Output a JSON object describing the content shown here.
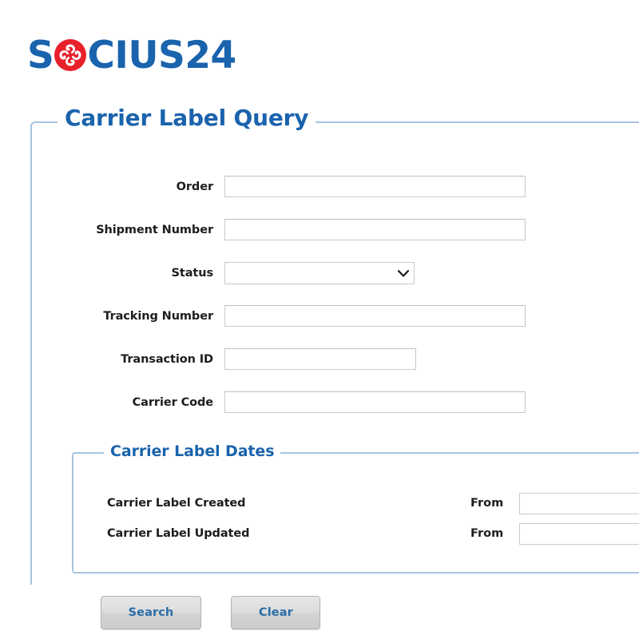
{
  "branding": {
    "logo_text_before": "S",
    "logo_mark": "socius-pinwheel-icon",
    "logo_text_after": "CIUS24",
    "logo_blue": "#1a63ad",
    "logo_red": "#e8202a"
  },
  "query_panel": {
    "legend": "Carrier Label Query",
    "border_color": "#a8c4e0",
    "fields": [
      {
        "label": "Order",
        "type": "text",
        "value": "",
        "placeholder": ""
      },
      {
        "label": "Shipment Number",
        "type": "text",
        "value": "",
        "placeholder": ""
      },
      {
        "label": "Status",
        "type": "select",
        "value": "",
        "options": [
          ""
        ]
      },
      {
        "label": "Tracking Number",
        "type": "text",
        "value": "",
        "placeholder": ""
      },
      {
        "label": "Transaction ID",
        "type": "text",
        "value": "",
        "placeholder": ""
      },
      {
        "label": "Carrier Code",
        "type": "text",
        "value": "",
        "placeholder": ""
      }
    ]
  },
  "dates_panel": {
    "legend": "Carrier Label Dates",
    "rows": [
      {
        "label": "Carrier Label Created",
        "from_label": "From",
        "from_value": "",
        "from_placeholder": ""
      },
      {
        "label": "Carrier Label Updated",
        "from_label": "From",
        "from_value": "",
        "from_placeholder": ""
      }
    ]
  },
  "actions": {
    "search_label": "Search",
    "clear_label": "Clear",
    "text_color": "#2b6ca8"
  }
}
